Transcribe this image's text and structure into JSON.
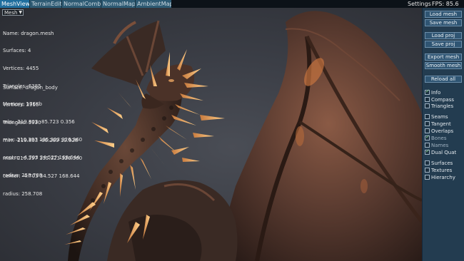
{
  "tabs": [
    {
      "label": "MeshViewer",
      "active": true
    },
    {
      "label": "TerrainEditor",
      "active": false
    },
    {
      "label": "NormalCombiner",
      "active": false
    },
    {
      "label": "NormalMapper",
      "active": false
    },
    {
      "label": "AmbientMapper",
      "active": false
    }
  ],
  "topbar": {
    "settings": "Settings",
    "fps": "FPS: 85.6"
  },
  "mesh_select": {
    "value": "Mesh"
  },
  "info": {
    "mesh": [
      "Name: dragon.mesh",
      "Surfaces: 4",
      "Vertices: 4455",
      "Triangles: 6385",
      "Memory: 176Kb",
      "min: -219.803 -85.723 0.356",
      "max: 210.397 135.323 326.360",
      "center: -4.703 34.527 168.644",
      "radius: 258.708"
    ],
    "surface": [
      "Surface: dragon_body",
      "Vertices: 3910",
      "Triangles: 5930",
      "min: -219.803 -66.269 10.928",
      "max: 210.397 135.323 326.360",
      "center: -4.703 34.527 168.644",
      "radius: 258.708"
    ]
  },
  "buttons": [
    {
      "name": "load-mesh-button",
      "label": "Load mesh"
    },
    {
      "name": "save-mesh-button",
      "label": "Save mesh"
    },
    {
      "name": "load-proj-button",
      "label": "Load proj"
    },
    {
      "name": "save-proj-button",
      "label": "Save proj"
    },
    {
      "name": "export-mesh-button",
      "label": "Export mesh"
    },
    {
      "name": "smooth-mesh-button",
      "label": "Smooth mesh"
    },
    {
      "name": "reload-all-button",
      "label": "Reload all"
    }
  ],
  "checks": [
    {
      "name": "info-checkbox",
      "label": "Info",
      "checked": true,
      "dim": false
    },
    {
      "name": "compass-checkbox",
      "label": "Compass",
      "checked": false,
      "dim": false
    },
    {
      "name": "triangles-checkbox",
      "label": "Triangles",
      "checked": false,
      "dim": false
    },
    {
      "name": "seams-checkbox",
      "label": "Seams",
      "checked": false,
      "dim": false
    },
    {
      "name": "tangent-checkbox",
      "label": "Tangent",
      "checked": false,
      "dim": false
    },
    {
      "name": "overlaps-checkbox",
      "label": "Overlaps",
      "checked": false,
      "dim": false
    },
    {
      "name": "bones-checkbox",
      "label": "Bones",
      "checked": true,
      "dim": true
    },
    {
      "name": "names-checkbox",
      "label": "Names",
      "checked": false,
      "dim": true
    },
    {
      "name": "dual-quat-checkbox",
      "label": "Dual Quat",
      "checked": true,
      "dim": false
    },
    {
      "name": "surfaces-checkbox",
      "label": "Surfaces",
      "checked": false,
      "dim": false
    },
    {
      "name": "textures-checkbox",
      "label": "Textures",
      "checked": false,
      "dim": false
    },
    {
      "name": "hierarchy-checkbox",
      "label": "Hierarchy",
      "checked": false,
      "dim": false
    }
  ]
}
